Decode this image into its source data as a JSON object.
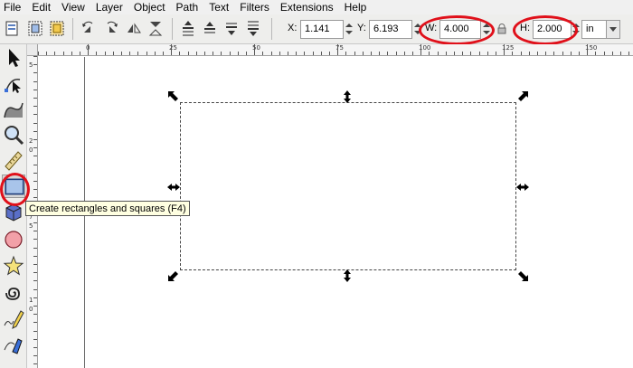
{
  "menubar": {
    "items": [
      {
        "label": "File"
      },
      {
        "label": "Edit"
      },
      {
        "label": "View"
      },
      {
        "label": "Layer"
      },
      {
        "label": "Object"
      },
      {
        "label": "Path"
      },
      {
        "label": "Text"
      },
      {
        "label": "Filters"
      },
      {
        "label": "Extensions"
      },
      {
        "label": "Help"
      }
    ]
  },
  "controls": {
    "x_label": "X:",
    "x_value": "1.141",
    "y_label": "Y:",
    "y_value": "6.193",
    "w_label": "W:",
    "w_value": "4.000",
    "h_label": "H:",
    "h_value": "2.000",
    "unit": "in"
  },
  "ruler": {
    "h_labels": [
      "0",
      "25",
      "50",
      "75",
      "100",
      "125",
      "150"
    ],
    "v_labels": [
      "5",
      "2",
      "0",
      "7",
      "5",
      "1",
      "0"
    ]
  },
  "tooltip": {
    "text": "Create rectangles and squares (F4)"
  },
  "colors": {
    "highlight": "#e0101a",
    "tooltip_bg": "#ffffe1"
  },
  "icons": {
    "toolbox": [
      "selector-arrow-icon",
      "node-editor-icon",
      "tweak-icon",
      "zoom-icon",
      "measure-icon",
      "rectangle-icon",
      "3d-box-icon",
      "ellipse-icon",
      "star-icon",
      "spiral-icon",
      "pencil-icon",
      "pen-icon"
    ]
  }
}
